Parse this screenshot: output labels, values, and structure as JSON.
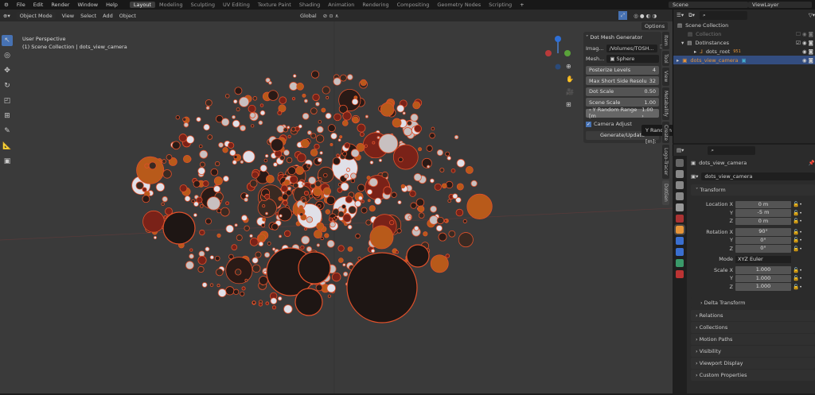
{
  "menu": {
    "items": [
      "File",
      "Edit",
      "Render",
      "Window",
      "Help"
    ],
    "workspaces": [
      "Layout",
      "Modeling",
      "Sculpting",
      "UV Editing",
      "Texture Paint",
      "Shading",
      "Animation",
      "Rendering",
      "Compositing",
      "Geometry Nodes",
      "Scripting"
    ],
    "active_workspace": "Layout",
    "scene": "Scene",
    "view_layer": "ViewLayer"
  },
  "viewport_header": {
    "mode": "Object Mode",
    "menus": [
      "View",
      "Select",
      "Add",
      "Object"
    ],
    "orientation": "Global",
    "options": "Options"
  },
  "viewport": {
    "view_name": "User Perspective",
    "collection_info": "(1) Scene Collection | dots_view_camera"
  },
  "npanel": {
    "title": "Dot Mesh Generator",
    "image_label": "Imag...",
    "image_value": "/Volumes/TOSH...",
    "mesh_label": "Mesh...",
    "mesh_value": "Sphere",
    "fields": [
      {
        "label": "Posterize Levels",
        "value": "4"
      },
      {
        "label": "Max Short Side Resolu",
        "value": "32"
      },
      {
        "label": "Dot Scale",
        "value": "0.50"
      },
      {
        "label": "Scene Scale",
        "value": "1.00"
      }
    ],
    "y_random_label": "Y Random Range [m",
    "y_random_value": "1.00",
    "camera_adjust": "Camera Adjust",
    "camera_adjust_checked": true,
    "generate": "Generate/Update",
    "tabs": [
      "Item",
      "Tool",
      "View",
      "Metaballify",
      "Create",
      "Logo-Tracer",
      "DotGen"
    ],
    "active_tab": "DotGen"
  },
  "tooltip": "Y Random Range [m]:",
  "outliner": {
    "rows": [
      {
        "name": "Scene Collection"
      },
      {
        "name": "Collection"
      },
      {
        "name": "DotInstances"
      },
      {
        "name": "dots_root",
        "badge": "951"
      },
      {
        "name": "dots_view_camera"
      }
    ]
  },
  "properties": {
    "object_name": "dots_view_camera",
    "data_name": "dots_view_camera",
    "transform": "Transform",
    "location": {
      "label": "Location X",
      "x": "0 m",
      "y": "-5 m",
      "z": "0 m"
    },
    "rotation": {
      "label": "Rotation X",
      "x": "90°",
      "y": "0°",
      "z": "0°"
    },
    "mode_label": "Mode",
    "mode": "XYZ Euler",
    "scale": {
      "label": "Scale X",
      "x": "1.000",
      "y": "1.000",
      "z": "1.000"
    },
    "axis": {
      "y": "Y",
      "z": "Z"
    },
    "sections": [
      "Delta Transform",
      "Relations",
      "Collections",
      "Motion Paths",
      "Visibility",
      "Viewport Display",
      "Custom Properties"
    ]
  },
  "colors": {
    "accent": "#4772b3",
    "selection": "#334d80",
    "dot": "#e0502a"
  }
}
